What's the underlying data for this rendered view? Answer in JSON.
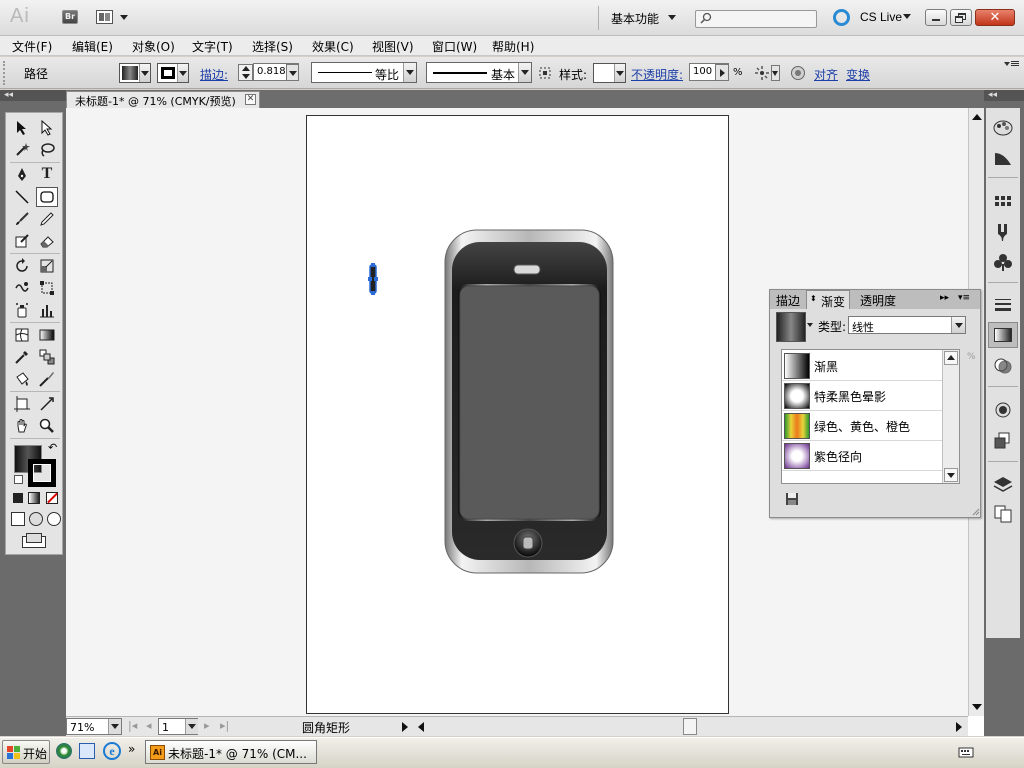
{
  "window": {
    "app_logo": "Ai",
    "bridge_label": "Br",
    "workspace": "基本功能",
    "search_placeholder": "",
    "cslive": "CS Live"
  },
  "menu": [
    "文件(F)",
    "编辑(E)",
    "对象(O)",
    "文字(T)",
    "选择(S)",
    "效果(C)",
    "视图(V)",
    "窗口(W)",
    "帮助(H)"
  ],
  "control": {
    "object_type": "路径",
    "stroke_label": "描边:",
    "stroke_weight": "0.818 p",
    "stroke_profile": "等比",
    "brush": "基本",
    "style_label": "样式:",
    "opacity_label": "不透明度:",
    "opacity_value": "100",
    "opacity_unit": "%",
    "align_link": "对齐",
    "transform_link": "变换"
  },
  "document": {
    "tab_title": "未标题-1* @ 71% (CMYK/预览)",
    "zoom": "71%",
    "artboard_number": "1",
    "status_text": "圆角矩形"
  },
  "gradient_panel": {
    "tabs": [
      "描边",
      "渐变",
      "透明度"
    ],
    "active_tab": "渐变",
    "type_label": "类型:",
    "type_value": "线性",
    "percent": "%",
    "presets": [
      {
        "name": "渐黑"
      },
      {
        "name": "特柔黑色晕影"
      },
      {
        "name": "绿色、黄色、橙色"
      },
      {
        "name": "紫色径向"
      }
    ]
  },
  "taskbar": {
    "start": "开始",
    "app_task": "未标题-1* @ 71% (CM..."
  },
  "colors": {
    "accent_link": "#1c3fa8",
    "close_button": "#c2351a"
  }
}
